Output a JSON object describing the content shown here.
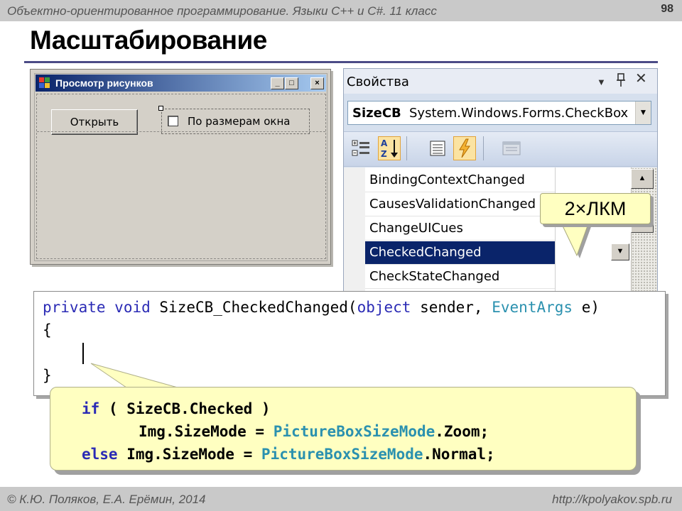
{
  "header": {
    "course": "Объектно-ориентированное программирование. Языки С++ и С#. 11 класс",
    "page_number": "98"
  },
  "slide_title": "Масштабирование",
  "form_designer": {
    "window_title": "Просмотр рисунков",
    "caption_buttons": {
      "minimize": "_",
      "maximize": "□",
      "close": "×"
    },
    "open_button_label": "Открыть",
    "checkbox_label": "По размерам окна",
    "checkbox_checked": false
  },
  "properties_panel": {
    "title": "Свойства",
    "header_icons": [
      "dropdown-icon",
      "pin-icon",
      "close-icon"
    ],
    "object_name": "SizeCB",
    "object_type": "System.Windows.Forms.CheckBox",
    "toolbar_icons": [
      "categorized-icon",
      "alphabetical-icon",
      "properties-icon",
      "events-icon",
      "property-pages-icon"
    ],
    "active_tools": [
      "alphabetical-icon",
      "events-icon"
    ],
    "events": [
      {
        "name": "BindingContextChanged",
        "selected": false
      },
      {
        "name": "CausesValidationChanged",
        "selected": false
      },
      {
        "name": "ChangeUICues",
        "selected": false
      },
      {
        "name": "CheckedChanged",
        "selected": true
      },
      {
        "name": "CheckStateChanged",
        "selected": false
      }
    ]
  },
  "callout_click": "2×ЛКМ",
  "code_editor": {
    "signature": {
      "kw_private": "private",
      "kw_void": "void",
      "method": "SizeCB_CheckedChanged(",
      "kw_object": "object",
      "sender": "sender,",
      "type_eventargs": "EventArgs",
      "param_e": "e)"
    },
    "open_brace": "{",
    "close_brace": "}"
  },
  "snippet": {
    "line1": {
      "kw_if": "if",
      "rest": "( SizeCB.Checked )"
    },
    "line2": {
      "lhs": "Img.SizeMode",
      "eq": "=",
      "type": "PictureBoxSizeMode",
      "rest": ".Zoom;"
    },
    "line3": {
      "kw_else": "else",
      "lhs": "Img.SizeMode",
      "eq": "=",
      "type": "PictureBoxSizeMode",
      "rest": ".Normal;"
    }
  },
  "footer": {
    "authors": "© К.Ю. Поляков, Е.А. Ерёмин, 2014",
    "site": "http://kpolyakov.spb.ru"
  },
  "colors": {
    "title_rule": "#4b4b86",
    "caption_gradient_start": "#0a246a",
    "caption_gradient_end": "#a6caf0",
    "selected_row": "#0a246a",
    "keyword": "#2b2bb5",
    "type_name": "#2b91af",
    "callout_fill": "#ffffc1",
    "chrome_gray": "#c9c9c9"
  }
}
